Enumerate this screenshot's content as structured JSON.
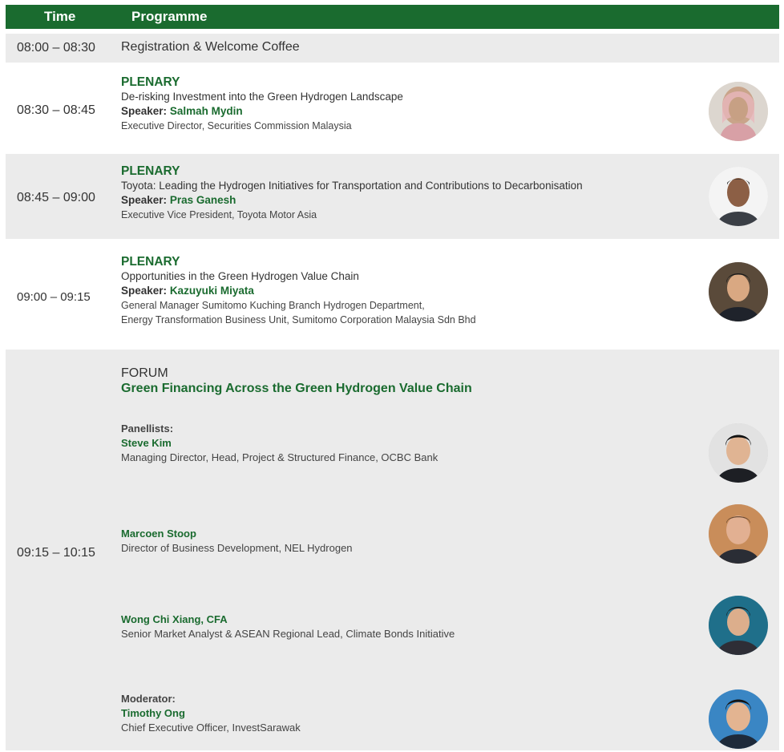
{
  "header": {
    "time": "Time",
    "programme": "Programme"
  },
  "rows": [
    {
      "time": "08:00 – 08:30",
      "title": "Registration & Welcome Coffee"
    },
    {
      "time": "08:30 – 08:45",
      "label": "PLENARY",
      "title": "De-risking Investment into the Green Hydrogen Landscape",
      "speaker_label": "Speaker:",
      "speaker": "Salmah Mydin",
      "role": "Executive Director, Securities Commission Malaysia"
    },
    {
      "time": "08:45 – 09:00",
      "label": "PLENARY",
      "title": "Toyota: Leading the Hydrogen Initiatives for Transportation and Contributions to Decarbonisation",
      "speaker_label": "Speaker:",
      "speaker": "Pras Ganesh",
      "role": "Executive Vice President, Toyota Motor Asia"
    },
    {
      "time": "09:00 – 09:15",
      "label": "PLENARY",
      "title": "Opportunities in the Green Hydrogen Value Chain",
      "speaker_label": "Speaker:",
      "speaker": "Kazuyuki Miyata",
      "role": "General Manager Sumitomo Kuching Branch Hydrogen Department,",
      "role2": "Energy Transformation Business Unit, Sumitomo Corporation Malaysia Sdn Bhd"
    }
  ],
  "forum": {
    "time": "09:15 – 10:15",
    "tag": "FORUM",
    "title": "Green Financing Across the Green Hydrogen Value Chain",
    "panellists_label": "Panellists:",
    "moderator_label": "Moderator:",
    "people": [
      {
        "name": "Steve Kim",
        "role": "Managing Director, Head, Project & Structured Finance, OCBC Bank"
      },
      {
        "name": "Marcoen Stoop",
        "role": "Director of Business Development, NEL Hydrogen"
      },
      {
        "name": "Wong Chi Xiang, CFA",
        "role": "Senior Market Analyst & ASEAN Regional Lead, Climate Bonds Initiative"
      },
      {
        "name": "Timothy Ong",
        "role": "Chief Executive Officer, InvestSarawak"
      }
    ]
  },
  "colors": {
    "brand_green": "#1a6b2f",
    "row_grey": "#ebebeb"
  }
}
